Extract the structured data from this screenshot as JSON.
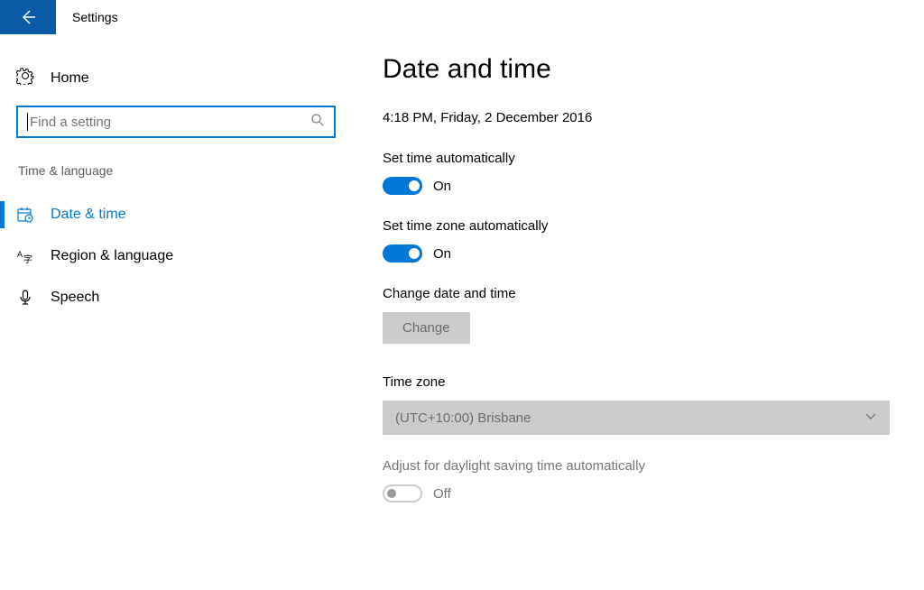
{
  "header": {
    "title": "Settings"
  },
  "sidebar": {
    "home_label": "Home",
    "search_placeholder": "Find a setting",
    "category_label": "Time & language",
    "items": [
      {
        "label": "Date & time"
      },
      {
        "label": "Region & language"
      },
      {
        "label": "Speech"
      }
    ]
  },
  "main": {
    "page_title": "Date and time",
    "datetime_display": "4:18 PM, Friday, 2 December 2016",
    "set_time_auto_label": "Set time automatically",
    "set_time_auto_state": "On",
    "set_timezone_auto_label": "Set time zone automatically",
    "set_timezone_auto_state": "On",
    "change_datetime_label": "Change date and time",
    "change_button_label": "Change",
    "timezone_label": "Time zone",
    "timezone_value": "(UTC+10:00) Brisbane",
    "dst_label": "Adjust for daylight saving time automatically",
    "dst_state": "Off"
  }
}
